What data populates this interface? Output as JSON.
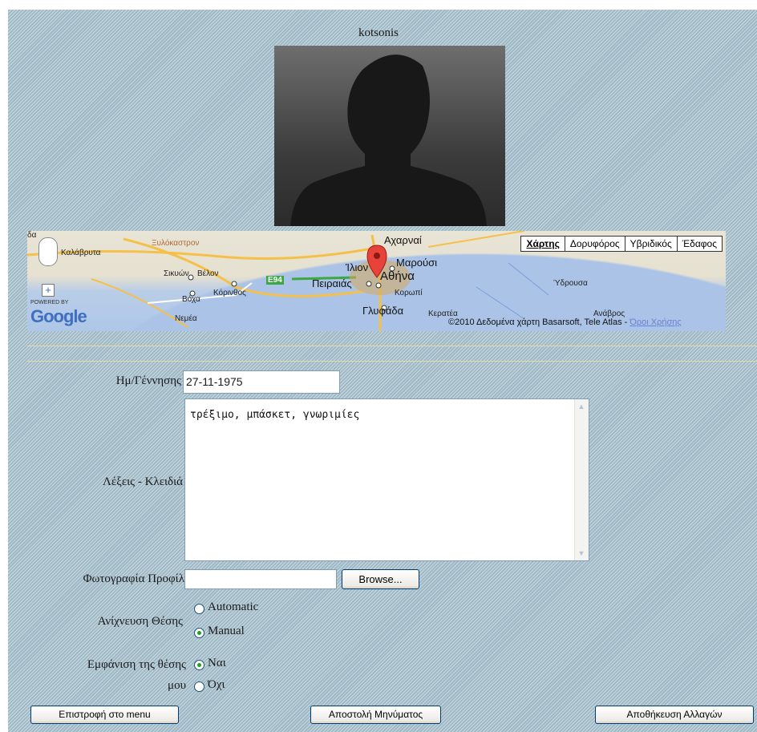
{
  "profile": {
    "username": "kotsonis"
  },
  "map": {
    "map_types": [
      "Χάρτης",
      "Δορυφόρος",
      "Υβριδικός",
      "Έδαφος"
    ],
    "places": [
      "Καλάβρυτα",
      "Ξυλόκαστρον",
      "Σικυών",
      "Βέλον",
      "Κόρινθος",
      "Βόχα",
      "Νεμέα",
      "Αχαρναί",
      "Ίλιον",
      "Μαρούσι",
      "Πειραιάς",
      "Αθήνα",
      "Κορωπί",
      "Γλυφάδα",
      "Κερατέα",
      "Ύδρουσα",
      "Ανάβρος",
      "E94",
      "δα"
    ],
    "copyright": "©2010 Δεδομένα χάρτη Basarsoft, Tele Atlas - ",
    "terms_link": "Όροι Χρήσης",
    "powered_by": "POWERED BY",
    "logo": "Google"
  },
  "form": {
    "birthdate_label": "Ημ/Γέννησης",
    "birthdate_value": "27-11-1975",
    "keywords_label": "Λέξεις - Κλειδιά",
    "keywords_value": "τρέξιμο, μπάσκετ, γνωριμίες",
    "photo_label": "Φωτογραφία Προφίλ",
    "photo_value": "",
    "browse_label": "Browse...",
    "location_detection_label": "Ανίχνευση Θέσης",
    "location_options": [
      {
        "label": "Automatic",
        "selected": false
      },
      {
        "label": "Manual",
        "selected": true
      }
    ],
    "show_location_label_line1": "Εμφάνιση της θέσης",
    "show_location_label_line2": "μου",
    "show_options": [
      {
        "label": "Ναι",
        "selected": true
      },
      {
        "label": "Όχι",
        "selected": false
      }
    ]
  },
  "buttons": {
    "back": "Επιστροφή στο menu",
    "send_message": "Αποστολή Μηνύματος",
    "save": "Αποθήκευση Αλλαγών"
  },
  "colors": {
    "background": "#9fb9c6",
    "divider": "#e6d9a8",
    "map_marker": "#e8433a"
  }
}
